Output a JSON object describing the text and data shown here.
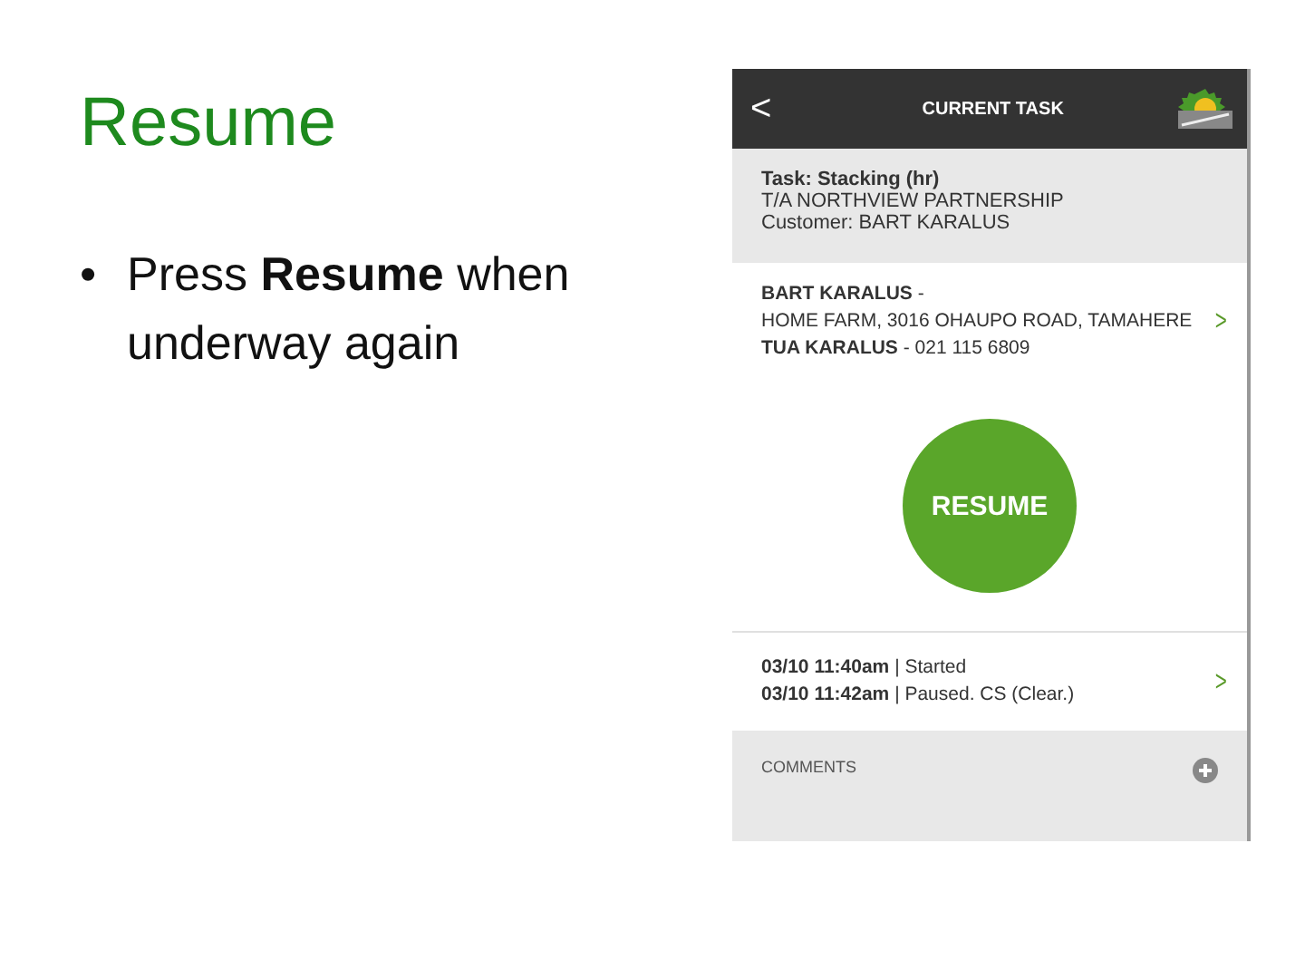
{
  "slide": {
    "title": "Resume",
    "bullets": [
      {
        "marker": "•",
        "text": "Press **Resume** when underway again"
      }
    ]
  },
  "app": {
    "header": {
      "back": "<",
      "title": "CURRENT TASK"
    },
    "task": {
      "name": "Task: Stacking (hr)",
      "lines": [
        "T/A  NORTHVIEW PARTNERSHIP",
        "Customer: BART KARALUS"
      ]
    },
    "contact": {
      "lines": [
        "**BART KARALUS** -",
        "HOME FARM, 3016 OHAUPO ROAD, TAMAHERE",
        "**TUA KARALUS** - 021 115 6809"
      ],
      "chevron": ">"
    },
    "action_button": "RESUME",
    "events": {
      "lines": [
        "**03/10 11:40am** | Started",
        "**03/10 11:42am** | Paused. CS (Clear.)"
      ],
      "chevron": ">"
    },
    "comments": {
      "label": "COMMENTS"
    }
  }
}
